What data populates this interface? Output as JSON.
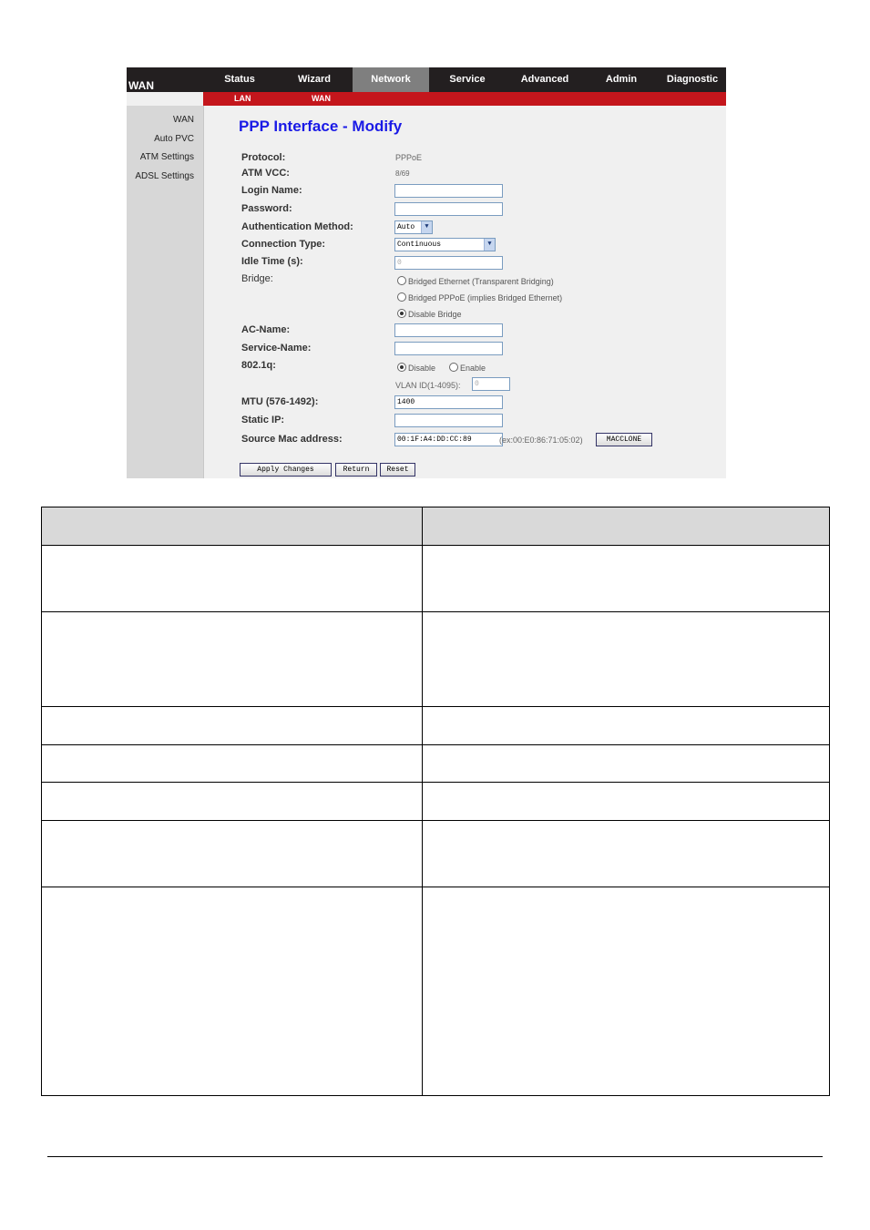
{
  "router": {
    "section_title": "WAN",
    "tabs": [
      "Status",
      "Wizard",
      "Network",
      "Service",
      "Advanced",
      "Admin",
      "Diagnostic"
    ],
    "active_tab": "Network",
    "subtabs": [
      "LAN",
      "WAN"
    ],
    "sidebar": [
      "WAN",
      "Auto PVC",
      "ATM Settings",
      "ADSL Settings"
    ],
    "page_title": "PPP Interface - Modify",
    "form": {
      "protocol_label": "Protocol:",
      "protocol_value": "PPPoE",
      "atm_vcc_label": "ATM VCC:",
      "atm_vcc_value": "8/69",
      "login_name_label": "Login Name:",
      "login_name_value": "",
      "password_label": "Password:",
      "password_value": "",
      "auth_method_label": "Authentication Method:",
      "auth_method_value": "Auto",
      "connection_type_label": "Connection Type:",
      "connection_type_value": "Continuous",
      "idle_time_label": "Idle Time (s):",
      "idle_time_value": "0",
      "bridge_label": "Bridge:",
      "bridge_options": [
        "Bridged Ethernet (Transparent Bridging)",
        "Bridged PPPoE (implies Bridged Ethernet)",
        "Disable Bridge"
      ],
      "bridge_selected": "Disable Bridge",
      "ac_name_label": "AC-Name:",
      "ac_name_value": "",
      "service_name_label": "Service-Name:",
      "service_name_value": "",
      "dot1q_label": "802.1q:",
      "dot1q_options": [
        "Disable",
        "Enable"
      ],
      "dot1q_selected": "Disable",
      "vlan_label": "VLAN ID(1-4095):",
      "vlan_value": "0",
      "mtu_label": "MTU (576-1492):",
      "mtu_value": "1400",
      "static_ip_label": "Static IP:",
      "static_ip_value": "",
      "mac_label": "Source Mac address:",
      "mac_value": "00:1F:A4:DD:CC:89",
      "mac_example": "(ex:00:E0:86:71:05:02)",
      "macclone_button": "MACCLONE"
    },
    "buttons": {
      "apply": "Apply Changes",
      "return": "Return",
      "reset": "Reset"
    }
  }
}
